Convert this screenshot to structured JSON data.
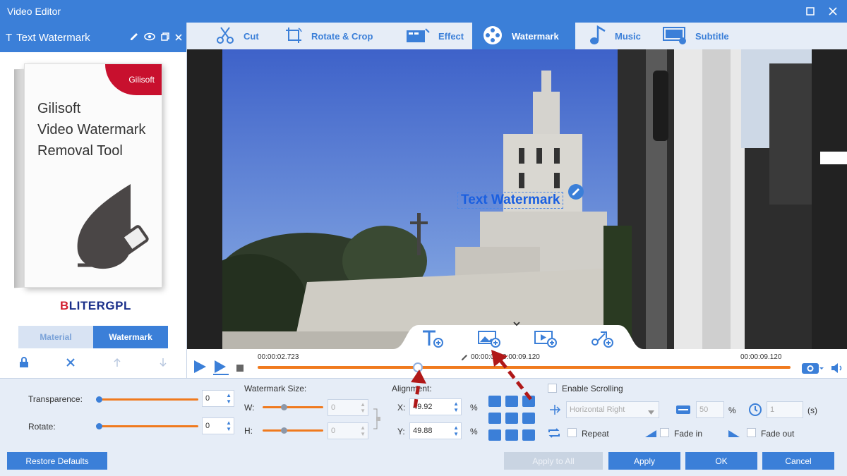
{
  "window": {
    "title": "Video Editor"
  },
  "left_panel": {
    "header_title": "Text Watermark",
    "product": {
      "brand": "Gilisoft",
      "title_lines": [
        "Gilisoft",
        "Video Watermark",
        "Removal Tool"
      ],
      "side_text": "Gilisoft Video Watermark Removal Tool"
    },
    "site_logo_prefix": "B",
    "site_logo_rest": "LITERGPL",
    "tabs": [
      {
        "label": "Material",
        "active": false
      },
      {
        "label": "Watermark",
        "active": true
      }
    ]
  },
  "toolbar": {
    "tabs": [
      {
        "label": "Cut",
        "icon": "cut-icon",
        "active": false
      },
      {
        "label": "Rotate & Crop",
        "icon": "crop-icon",
        "active": false
      },
      {
        "label": "Effect",
        "icon": "effect-icon",
        "active": false
      },
      {
        "label": "Watermark",
        "icon": "film-reel-icon",
        "active": true
      },
      {
        "label": "Music",
        "icon": "music-note-icon",
        "active": false
      },
      {
        "label": "Subtitle",
        "icon": "subtitle-icon",
        "active": false
      }
    ]
  },
  "preview": {
    "watermark_text": "Text Watermark"
  },
  "timeline": {
    "current_time": "00:00:02.723",
    "range": "00:00:0 -00:00:09.120",
    "end_time": "00:00:09.120",
    "position_fraction": 0.3
  },
  "settings": {
    "transparence_label": "Transparence:",
    "transparence_value": "0",
    "rotate_label": "Rotate:",
    "rotate_value": "0",
    "watermark_size_label": "Watermark Size:",
    "w_label": "W:",
    "w_value": "0",
    "h_label": "H:",
    "h_value": "0",
    "alignment_label": "Alignment:",
    "x_label": "X:",
    "x_value": "49.92",
    "y_label": "Y:",
    "y_value": "49.88",
    "percent": "%",
    "enable_scrolling": "Enable Scrolling",
    "direction": "Horizontal Right",
    "speed_value": "50",
    "duration_value": "1",
    "duration_unit": "(s)",
    "repeat": "Repeat",
    "fade_in": "Fade in",
    "fade_out": "Fade out"
  },
  "footer": {
    "restore_defaults": "Restore Defaults",
    "apply_to_all": "Apply to All",
    "apply": "Apply",
    "ok": "OK",
    "cancel": "Cancel"
  },
  "colors": {
    "accent": "#3b7fd8",
    "slider": "#f07a1e",
    "background": "#e6edf7"
  }
}
